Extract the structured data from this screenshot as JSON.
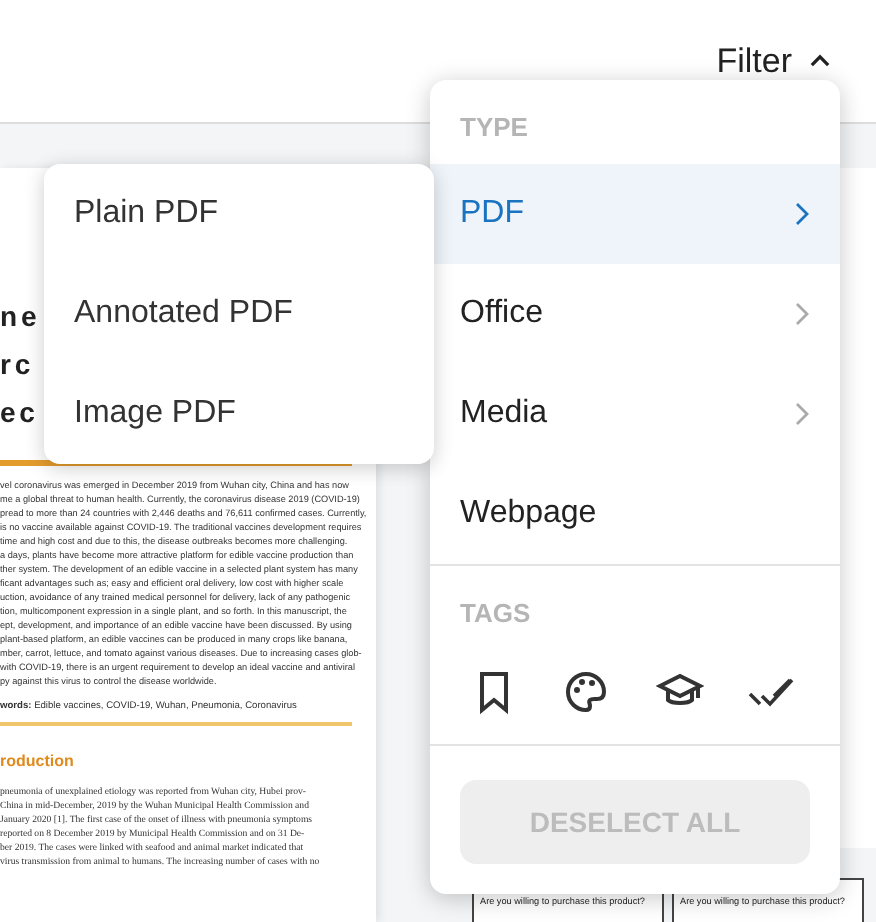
{
  "header": {
    "filter_label": "Filter",
    "filter_open": true
  },
  "document": {
    "title_lines": [
      "n e",
      "r c",
      "e c"
    ],
    "abstract_lines": [
      "vel coronavirus was emerged in December 2019 from Wuhan city, China and has now",
      "me a global threat to human health. Currently, the coronavirus disease 2019 (COVID-19)",
      "pread to more than 24 countries with 2,446 deaths and 76,611 confirmed cases. Currently,",
      "is no vaccine available against COVID-19. The traditional vaccines development requires",
      "time and high cost and due to this, the disease outbreaks becomes more challenging.",
      "a days, plants have become more attractive platform for edible vaccine production than",
      "ther system. The development of an edible vaccine in a selected plant system has many",
      "ficant advantages such as; easy and efficient oral delivery, low cost with higher scale",
      "uction, avoidance of any trained medical personnel for delivery, lack of any pathogenic",
      "tion, multicomponent expression in a single plant, and so forth. In this manuscript, the",
      "ept, development, and importance of an edible vaccine have been discussed. By using",
      "plant-based platform, an edible vaccines can be produced in many crops like banana,",
      "mber, carrot, lettuce, and tomato against various diseases. Due to increasing cases glob-",
      "with COVID-19, there is an urgent requirement to develop an ideal vaccine and antiviral",
      "py against this virus to control the disease worldwide."
    ],
    "keywords": "**words:** Edible vaccines, COVID-19, Wuhan, Pneumonia, Coronavirus",
    "section_heading": "roduction",
    "intro_lines": [
      "pneumonia of unexplained etiology was reported from Wuhan city, Hubei prov-",
      "China in mid-December, 2019 by the Wuhan Municipal Health Commission and",
      "January 2020 [1]. The first case of the onset of illness with pneumonia symptoms",
      "reported on 8 December 2019 by Municipal Health Commission and on 31 De-",
      "ber 2019. The cases were linked with seafood and animal market indicated that",
      "virus transmission from animal to humans. The increasing number of cases with no"
    ]
  },
  "survey_questions": [
    "Are you willing to purchase this product?",
    "Are you willing to purchase this product?"
  ],
  "submenu": {
    "items": [
      {
        "label": "Plain PDF"
      },
      {
        "label": "Annotated PDF"
      },
      {
        "label": "Image PDF"
      }
    ]
  },
  "type_menu": {
    "heading": "TYPE",
    "items": [
      {
        "label": "PDF",
        "selected": true,
        "has_submenu": true
      },
      {
        "label": "Office",
        "selected": false,
        "has_submenu": true
      },
      {
        "label": "Media",
        "selected": false,
        "has_submenu": true
      },
      {
        "label": "Webpage",
        "selected": false,
        "has_submenu": false
      }
    ]
  },
  "tags": {
    "heading": "TAGS"
  },
  "deselect_button": {
    "label": "DESELECT ALL",
    "disabled": true
  }
}
